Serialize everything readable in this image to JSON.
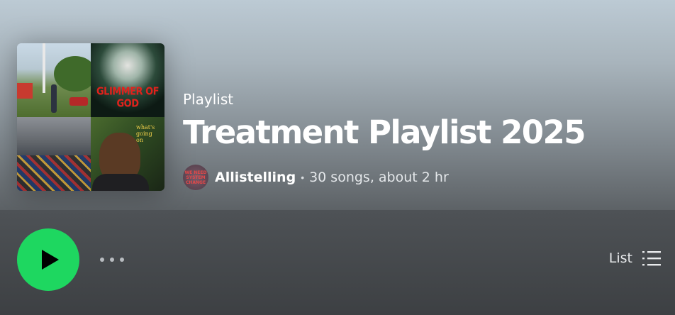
{
  "playlist": {
    "type_label": "Playlist",
    "title": "Treatment Playlist 2025",
    "owner": "Allistelling",
    "separator": "•",
    "stats": "30 songs, about 2 hr"
  },
  "cover": {
    "tiles": [
      {
        "name": "album-cover-field-icon"
      },
      {
        "name": "album-cover-glimmer-of-god",
        "text": "GLIMMER OF GOD"
      },
      {
        "name": "album-cover-junk-pile-icon"
      },
      {
        "name": "album-cover-whats-going-on",
        "text": "what's going on"
      }
    ]
  },
  "avatar": {
    "text": "WE NEED SYSTEM CHANGE"
  },
  "actions": {
    "play_icon": "play-icon",
    "more_icon": "more-options-icon",
    "view_label": "List",
    "view_icon": "list-view-icon"
  },
  "colors": {
    "accent": "#1ed760",
    "header_gradient_top": "#bccad4",
    "background": "#424548"
  }
}
